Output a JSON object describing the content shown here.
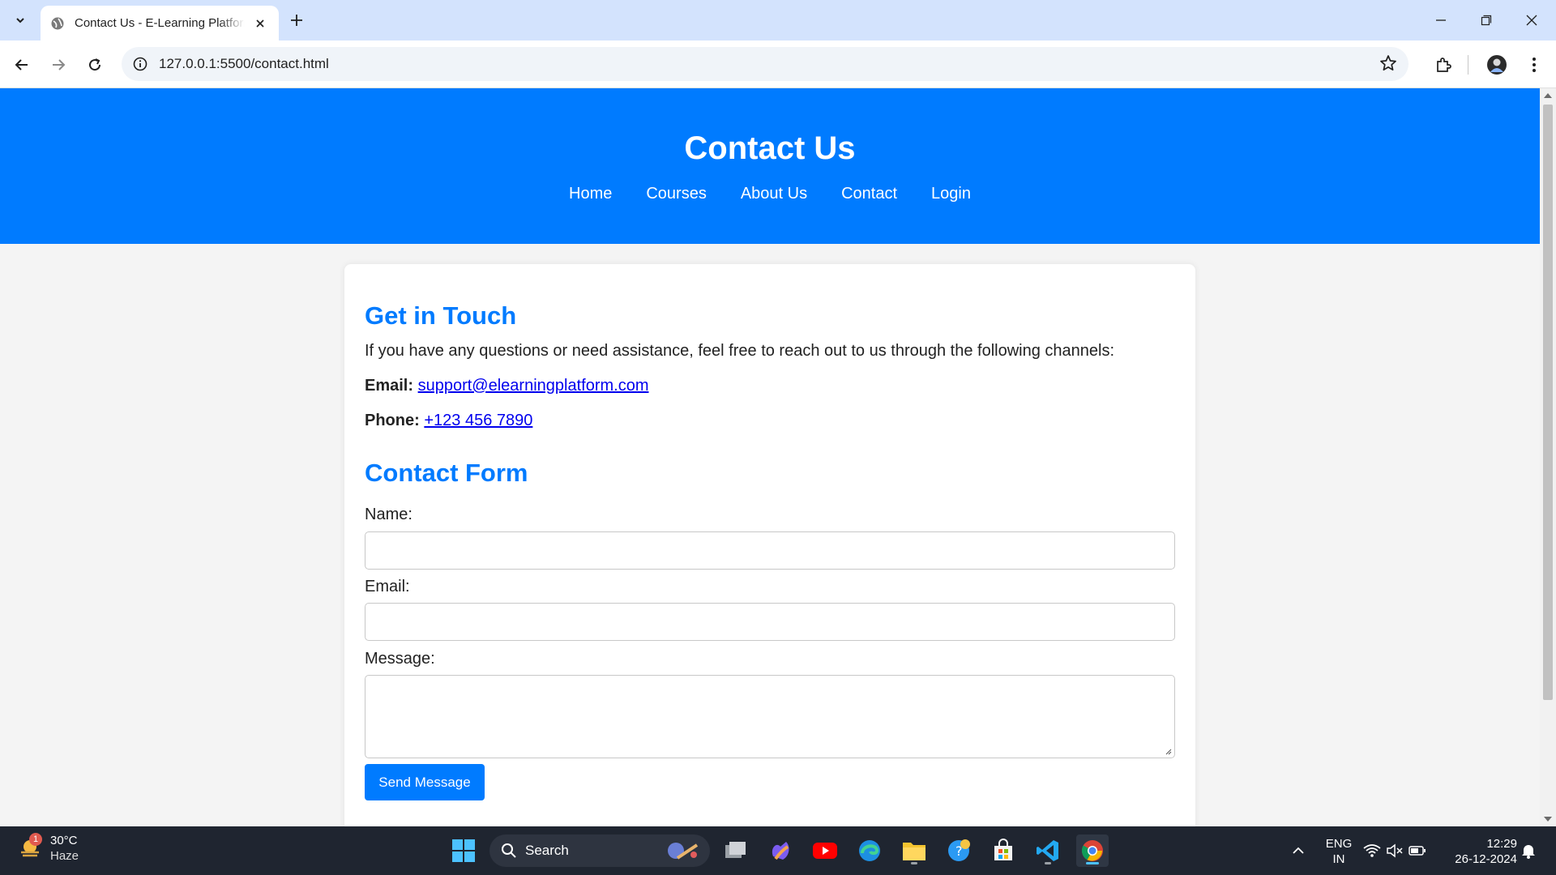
{
  "browser": {
    "tab_title": "Contact Us - E-Learning Platform",
    "url": "127.0.0.1:5500/contact.html"
  },
  "site": {
    "title": "Contact Us",
    "nav": [
      "Home",
      "Courses",
      "About Us",
      "Contact",
      "Login"
    ]
  },
  "card": {
    "heading": "Get in Touch",
    "intro": "If you have any questions or need assistance, feel free to reach out to us through the following channels:",
    "email_label": "Email:",
    "email_value": "support@elearningplatform.com",
    "phone_label": "Phone:",
    "phone_value": "+123 456 7890",
    "form_heading": "Contact Form",
    "name_label": "Name:",
    "email_field_label": "Email:",
    "message_label": "Message:",
    "name_value": "",
    "email_value_input": "",
    "message_value": "",
    "send_label": "Send Message"
  },
  "taskbar": {
    "weather_temp": "30°C",
    "weather_cond": "Haze",
    "weather_badge": "1",
    "search_label": "Search",
    "lang_line1": "ENG",
    "lang_line2": "IN",
    "time": "12:29",
    "date": "26-12-2024"
  },
  "colors": {
    "brand": "#007bff",
    "tabstrip": "#d3e3fd",
    "taskbar": "#1f2530"
  }
}
